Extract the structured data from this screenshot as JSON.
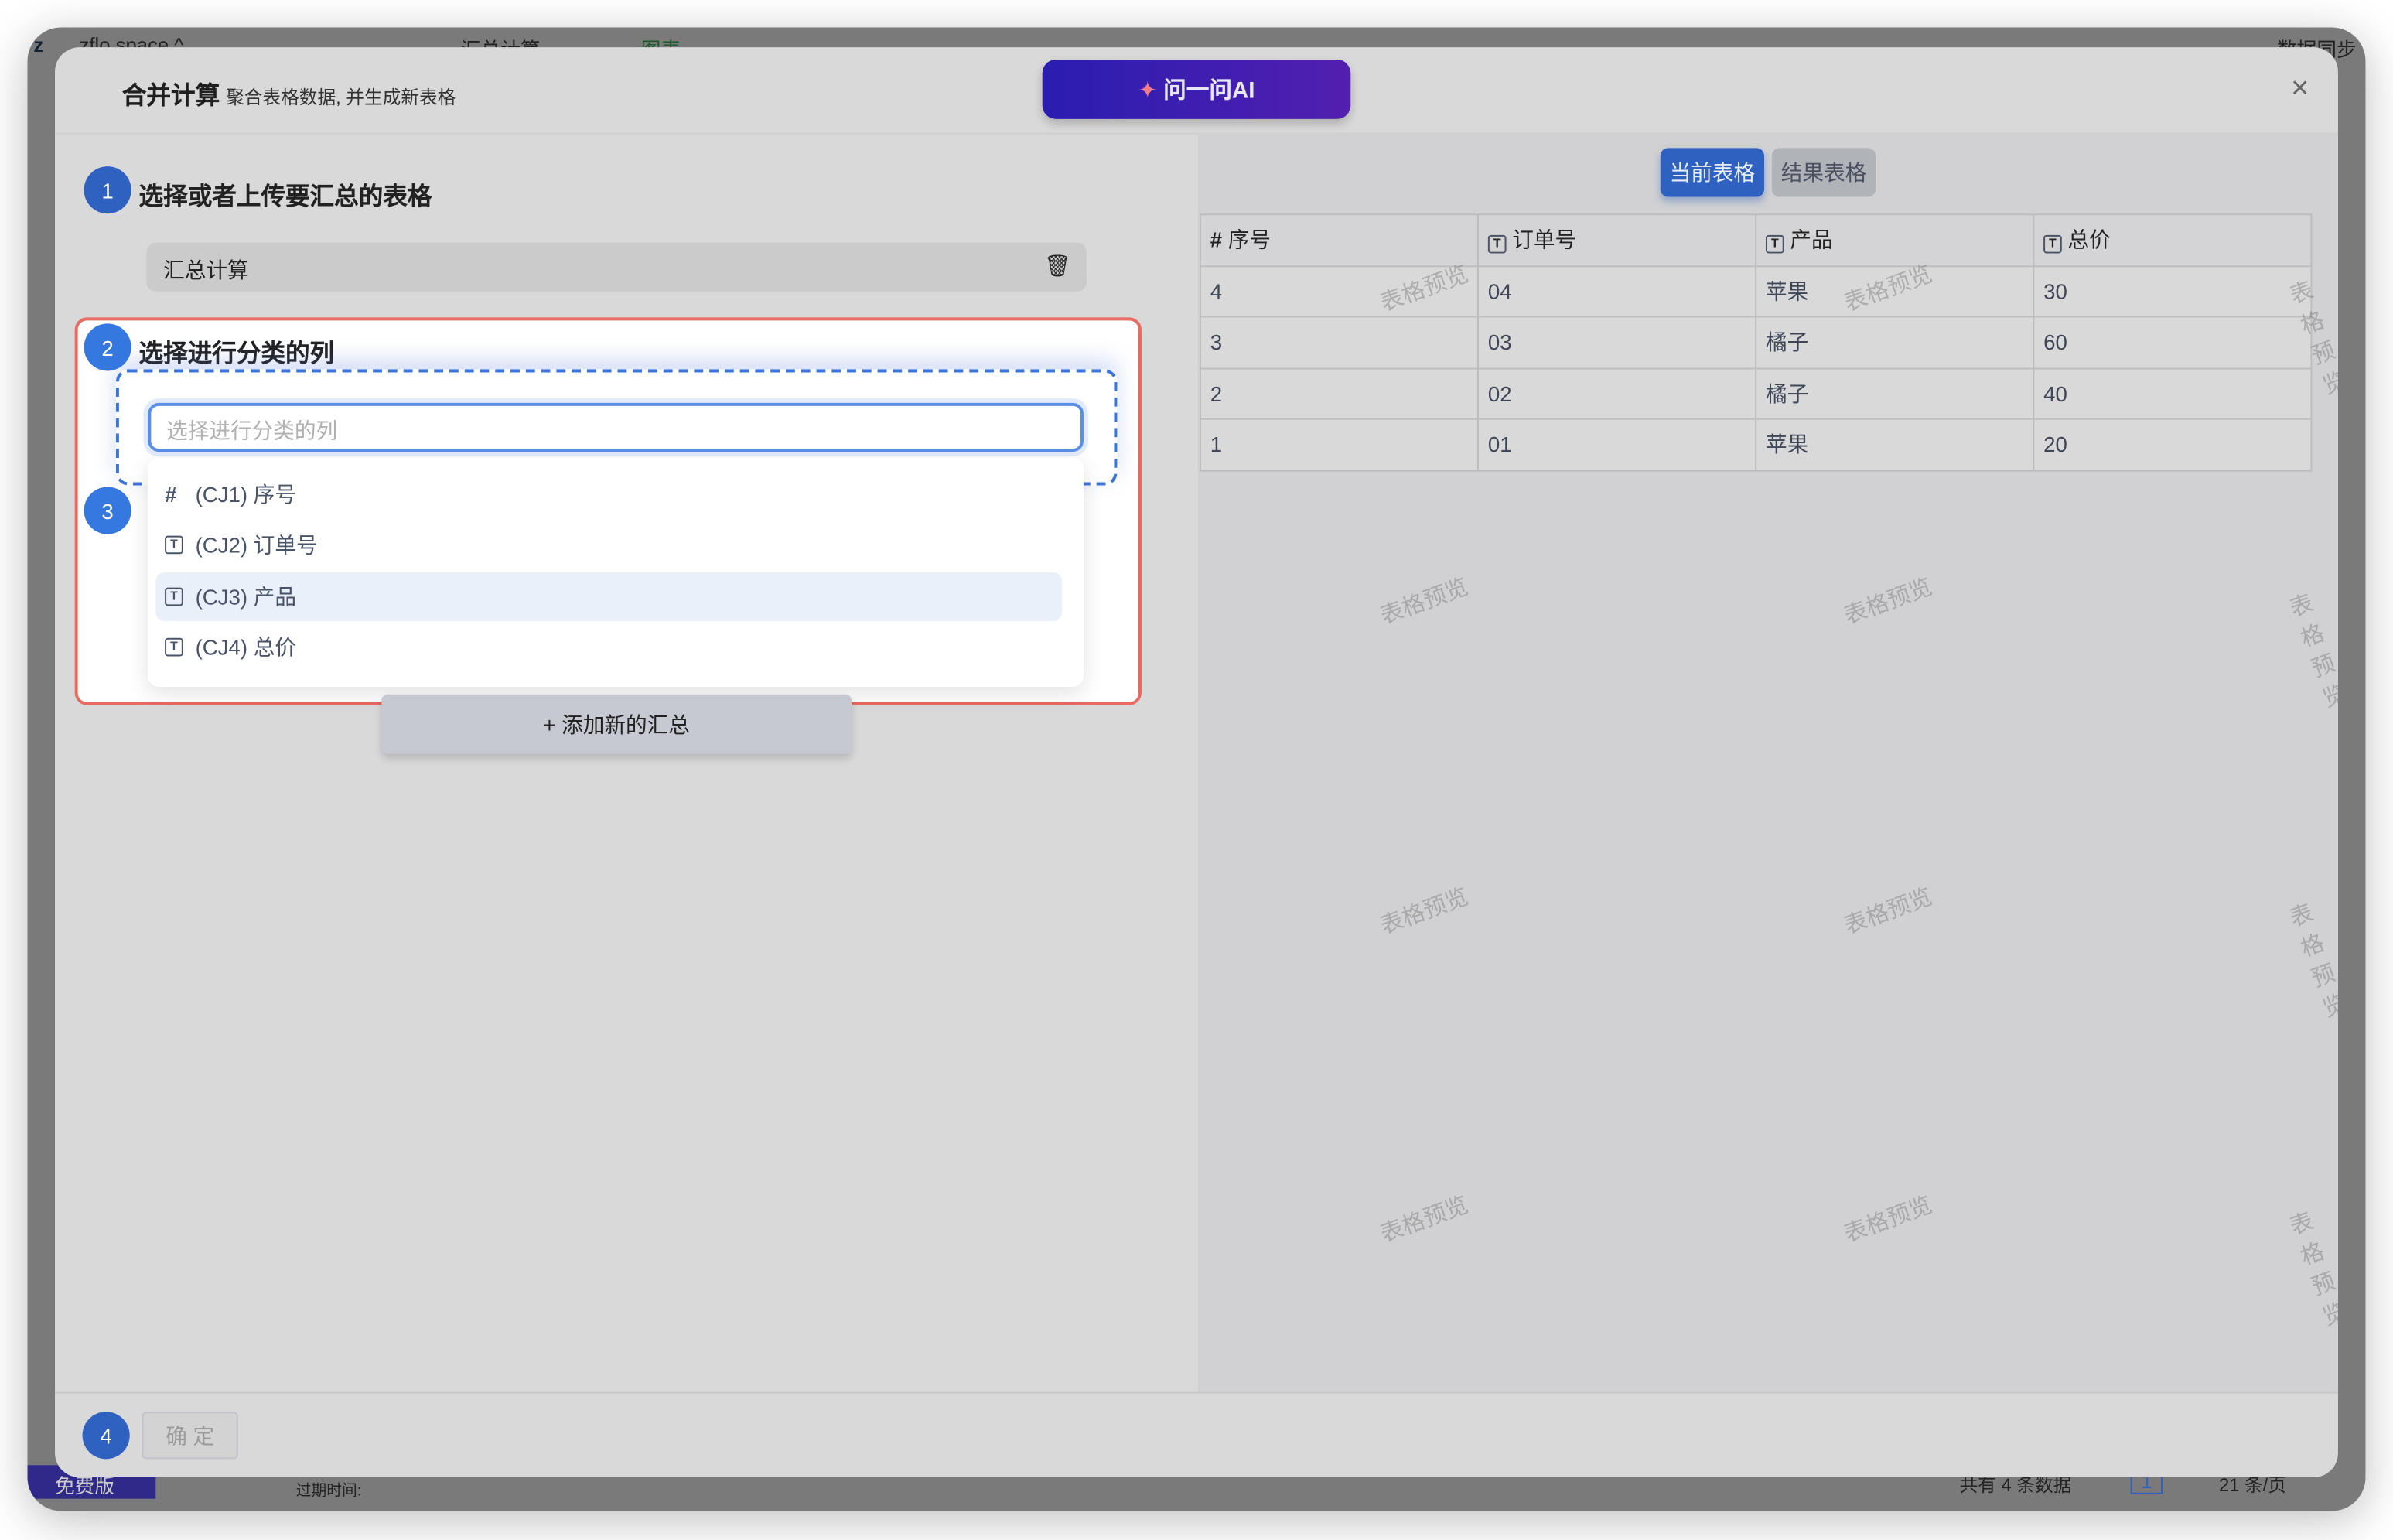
{
  "background": {
    "workspace_initial": "z",
    "workspace_name": "zflo space ^",
    "tab_sheet": "汇总计算",
    "tab_chart": "图表",
    "sync": "数据同步",
    "plan": "免费版",
    "expire": "过期时间:",
    "total": "共有 4 条数据",
    "page": "1",
    "page_size": "21 条/页"
  },
  "modal": {
    "title": "合并计算",
    "subtitle": "聚合表格数据, 并生成新表格",
    "ai_button": "问一问AI",
    "close": "×"
  },
  "steps": {
    "s1": {
      "num": "1",
      "label": "选择或者上传要汇总的表格",
      "table_name": "汇总计算"
    },
    "s2": {
      "num": "2",
      "label": "选择进行分类的列",
      "placeholder": "选择进行分类的列",
      "options": [
        {
          "icon": "#",
          "label": "(CJ1) 序号"
        },
        {
          "icon": "T",
          "label": "(CJ2) 订单号"
        },
        {
          "icon": "T",
          "label": "(CJ3) 产品"
        },
        {
          "icon": "T",
          "label": "(CJ4) 总价"
        }
      ]
    },
    "s3": {
      "num": "3"
    },
    "add_button": "+ 添加新的汇总",
    "s4": {
      "num": "4",
      "confirm": "确 定"
    }
  },
  "preview": {
    "tabs": [
      "当前表格",
      "结果表格"
    ],
    "watermark": "表格预览",
    "columns": [
      {
        "icon": "#",
        "label": "序号"
      },
      {
        "icon": "T",
        "label": "订单号"
      },
      {
        "icon": "T",
        "label": "产品"
      },
      {
        "icon": "T",
        "label": "总价"
      }
    ],
    "rows": [
      [
        "4",
        "04",
        "苹果",
        "30"
      ],
      [
        "3",
        "03",
        "橘子",
        "60"
      ],
      [
        "2",
        "02",
        "橘子",
        "40"
      ],
      [
        "1",
        "01",
        "苹果",
        "20"
      ]
    ]
  },
  "colors": {
    "accent": "#2f62c0",
    "highlight_border": "#e86a60",
    "ai_gradient_start": "#2a1db0",
    "ai_gradient_end": "#521fb0"
  }
}
